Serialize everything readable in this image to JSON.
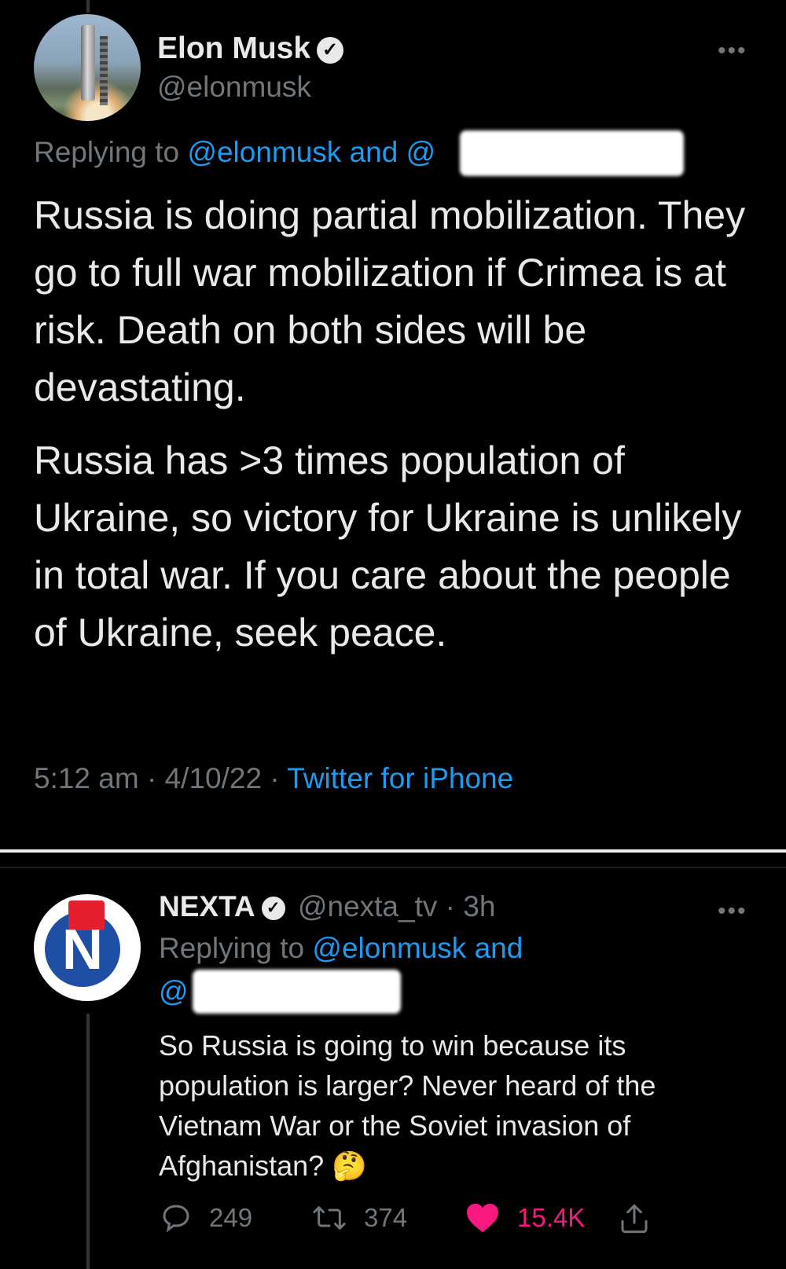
{
  "tweet": {
    "author_name": "Elon Musk",
    "verified_mark": "✓",
    "handle": "@elonmusk",
    "replying_prefix": "Replying to ",
    "replying_to": "@elonmusk and @",
    "paragraphs": [
      "Russia is doing partial mobilization. They go to full war mobilization if Crimea is at risk. Death on both sides will be devastating.",
      "Russia has >3 times population of Ukraine, so victory for Ukraine is unlikely in total war. If you care about the people of Ukraine, seek peace."
    ],
    "time": "5:12 am",
    "date": "4/10/22",
    "separator": "·",
    "source": "Twitter for iPhone",
    "more_label": "•••"
  },
  "reply": {
    "author_name": "NEXTA",
    "verified_mark": "✓",
    "handle": "@nexta_tv",
    "separator": "·",
    "age": "3h",
    "replying_prefix": "Replying to ",
    "replying_to_1": "@elonmusk and",
    "replying_to_2": "@",
    "text": "So Russia is going to win because its population is larger? Never heard of the Vietnam War or the Soviet invasion of Afghanistan?",
    "emoji": "🤔",
    "more_label": "•••",
    "stats": {
      "replies": "249",
      "retweets": "374",
      "likes": "15.4K"
    },
    "avatar_letter": "N"
  },
  "colors": {
    "background": "#000000",
    "text": "#e7e9ea",
    "secondary": "#71767b",
    "link": "#1d9bf0",
    "like": "#f91880"
  },
  "icons": [
    "verified-badge-icon",
    "more-icon",
    "reply-icon",
    "retweet-icon",
    "like-icon",
    "share-icon"
  ]
}
